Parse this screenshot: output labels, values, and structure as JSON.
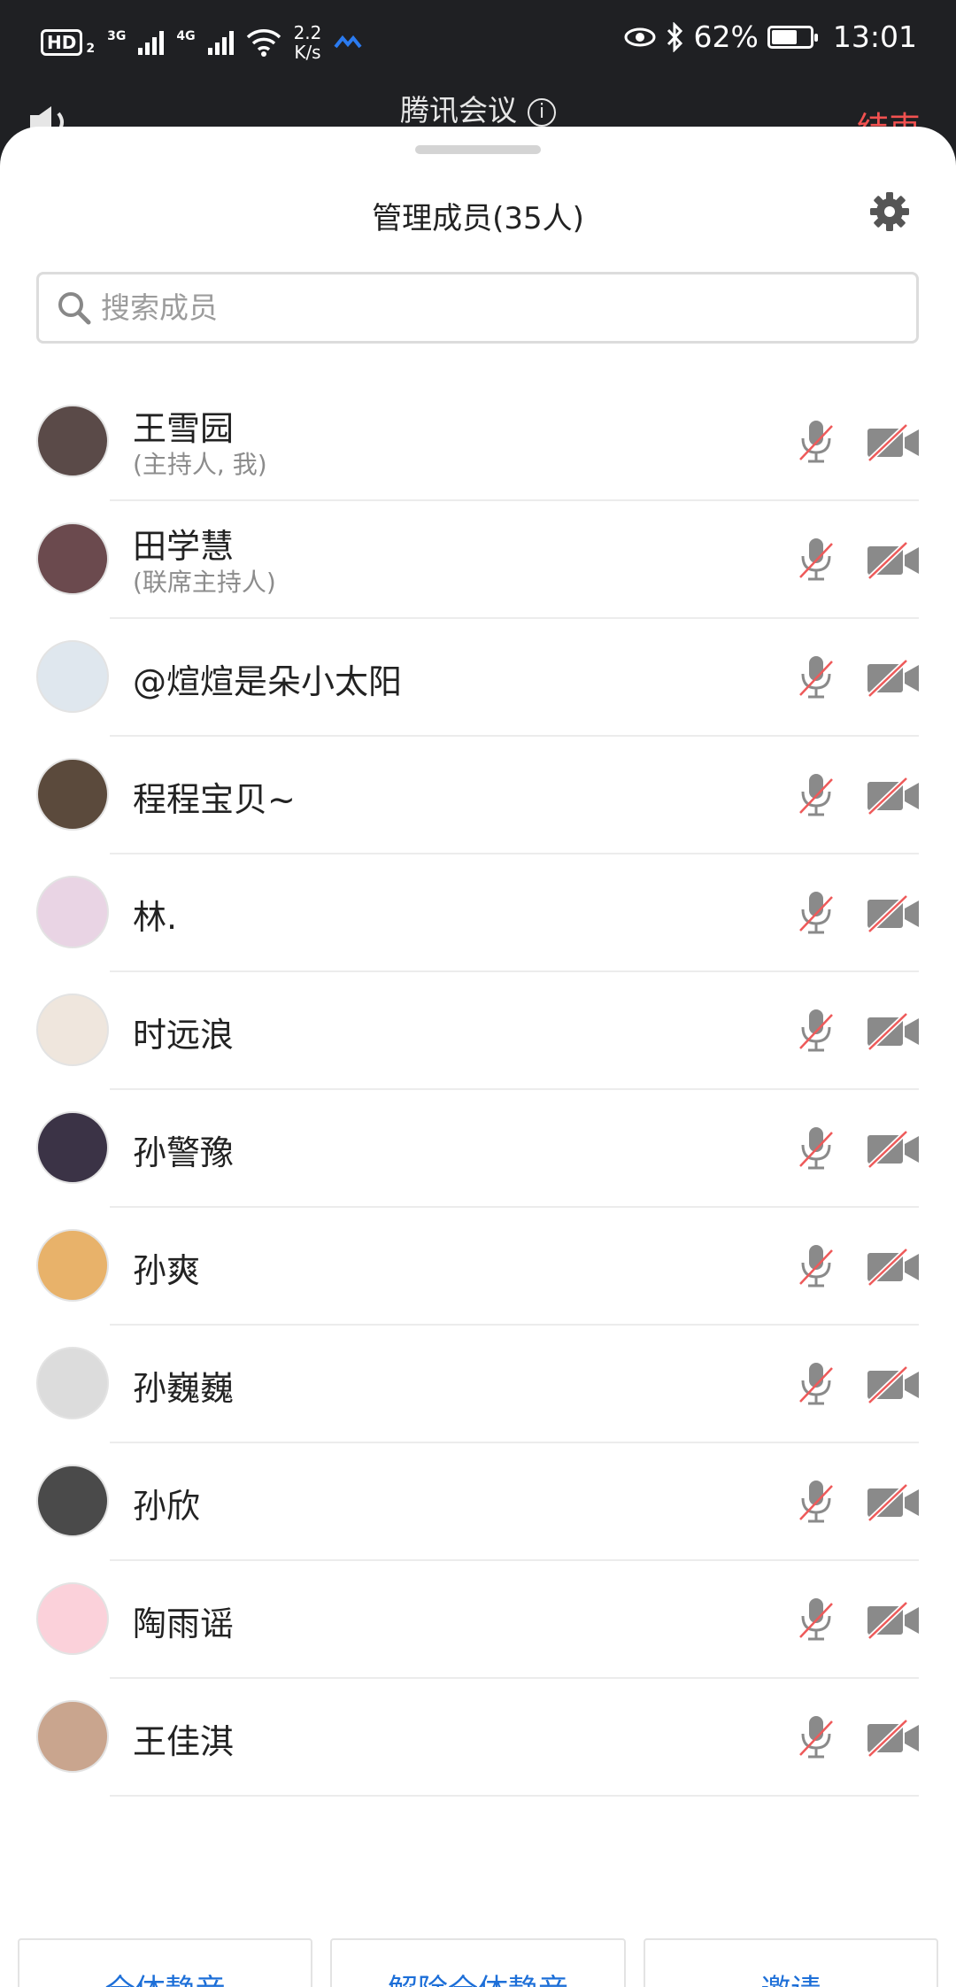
{
  "status_bar": {
    "hd_label": "HD",
    "hd_sub": "2",
    "net1": "3G",
    "net2": "4G",
    "speed_top": "2.2",
    "speed_bottom": "K/s",
    "battery_percent": "62%",
    "battery_level": 0.62,
    "time": "13:01"
  },
  "header": {
    "app_title": "腾讯会议",
    "info_glyph": "i",
    "end_label": "结束"
  },
  "sheet": {
    "title": "管理成员(35人)",
    "search_placeholder": "搜索成员"
  },
  "members": [
    {
      "name": "王雪园",
      "role": "(主持人, 我)"
    },
    {
      "name": "田学慧",
      "role": "(联席主持人)"
    },
    {
      "name": "@煊煊是朵小太阳",
      "role": ""
    },
    {
      "name": "程程宝贝~",
      "role": ""
    },
    {
      "name": "林.",
      "role": ""
    },
    {
      "name": "时远浪",
      "role": ""
    },
    {
      "name": "孙警豫",
      "role": ""
    },
    {
      "name": "孙爽",
      "role": ""
    },
    {
      "name": "孙巍巍",
      "role": ""
    },
    {
      "name": "孙欣",
      "role": ""
    },
    {
      "name": "陶雨谣",
      "role": ""
    },
    {
      "name": "王佳淇",
      "role": ""
    }
  ],
  "buttons": {
    "mute_all": "全体静音",
    "unmute_all": "解除全体静音",
    "invite": "邀请"
  },
  "colors": {
    "accent": "#1d6fd8",
    "danger": "#f25150",
    "header_bg": "#1f2023"
  }
}
